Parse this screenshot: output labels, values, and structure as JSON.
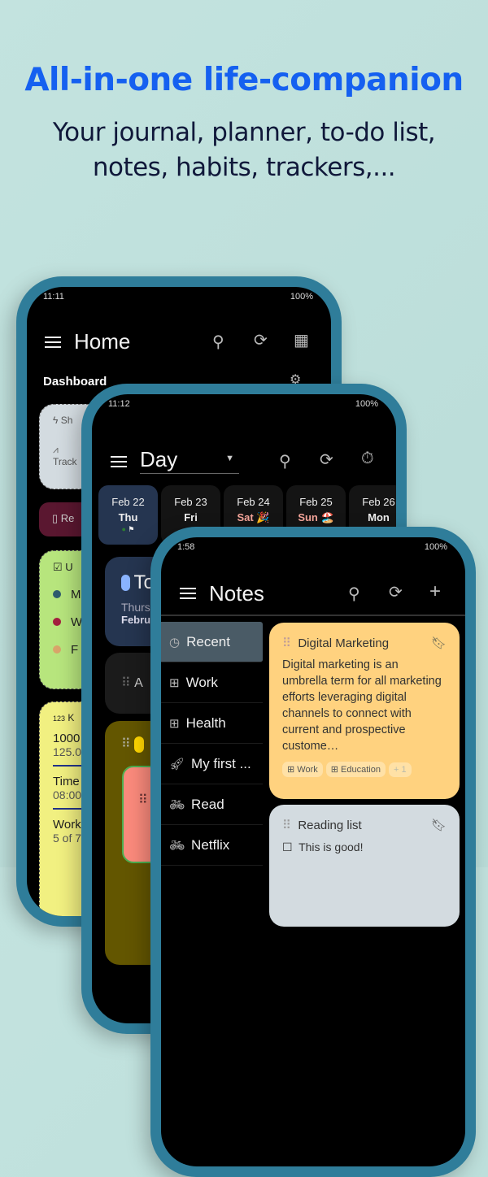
{
  "hero": {
    "title": "All-in-one life-companion",
    "subtitle_line1": "Your journal, planner, to-do list,",
    "subtitle_line2": "notes, habits, trackers,..."
  },
  "phone_home": {
    "time": "11:11",
    "battery": "100%",
    "title": "Home",
    "section": "Dashboard",
    "cards": {
      "c1_title": "Sh",
      "c1_sub": "Track",
      "c2_title": "Re",
      "c3_title": "U",
      "c3_items": [
        "M",
        "W",
        "F"
      ],
      "c3_colors": [
        "#2f5a6e",
        "#a3203f",
        "#d9a56a"
      ],
      "c4_title": "K",
      "c4_badge": "123",
      "c4_v1": "1000",
      "c4_v1sub": "125.0",
      "c4_v2": "Time",
      "c4_v2sub": "08:00",
      "c4_v3": "Work",
      "c4_v3sub": "5 of 7"
    }
  },
  "phone_day": {
    "time": "11:12",
    "battery": "100%",
    "title": "Day",
    "dates": [
      {
        "date": "Feb 22",
        "day": "Thu"
      },
      {
        "date": "Feb 23",
        "day": "Fri"
      },
      {
        "date": "Feb 24",
        "day": "Sat 🎉"
      },
      {
        "date": "Feb 25",
        "day": "Sun 🏖️"
      },
      {
        "date": "Feb 26",
        "day": "Mon"
      }
    ],
    "today_title": "To",
    "today_line1": "Thurs",
    "today_line2": "Febru",
    "card2_text": "A"
  },
  "phone_notes": {
    "time": "1:58",
    "battery": "100%",
    "title": "Notes",
    "sidebar": [
      {
        "label": "Recent",
        "icon": "clock-icon"
      },
      {
        "label": "Work",
        "icon": "category-icon"
      },
      {
        "label": "Health",
        "icon": "category-icon"
      },
      {
        "label": "My first ...",
        "icon": "rocket-icon"
      },
      {
        "label": "Read",
        "icon": "bike-icon"
      },
      {
        "label": "Netflix",
        "icon": "bike-icon"
      }
    ],
    "notes": [
      {
        "title": "Digital Marketing",
        "body": "Digital marketing is an umbrella term for all marketing efforts leveraging digital channels to connect with current and prospective custome…",
        "tags": [
          "Work",
          "Education"
        ],
        "more": "+ 1",
        "color": "#ffd27f"
      },
      {
        "title": "Reading list",
        "check_item": "This is good!",
        "color": "#d3dbe0"
      }
    ]
  },
  "colors": {
    "frame": "#2f7d9a",
    "title": "#1560f0"
  }
}
